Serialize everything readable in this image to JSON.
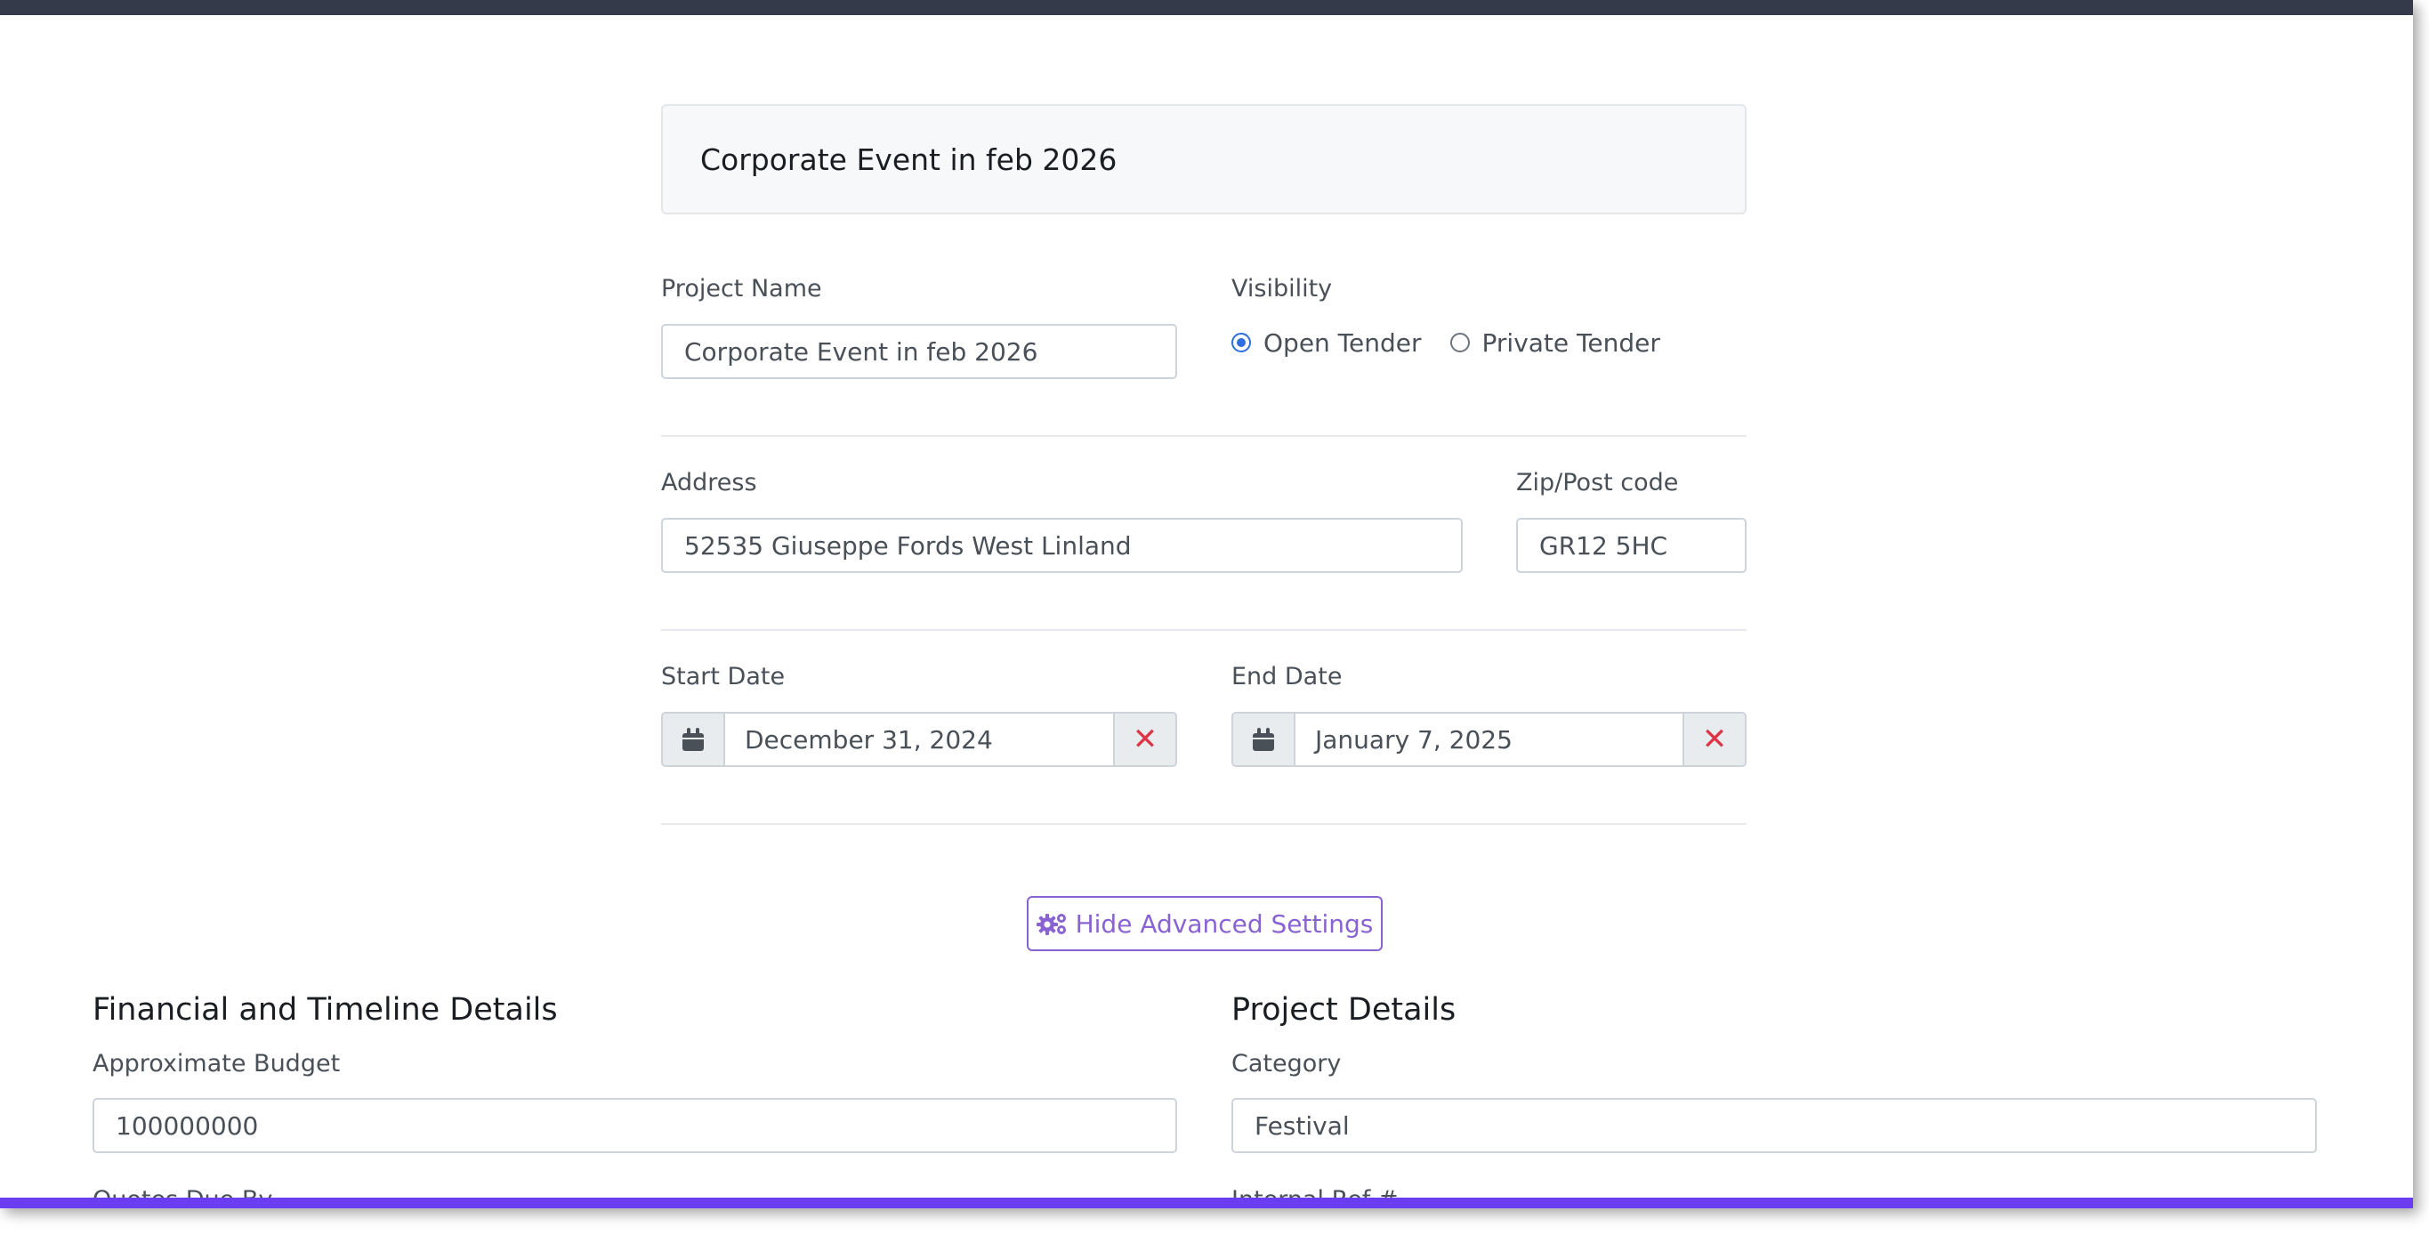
{
  "header": {
    "title": "Corporate Event in feb 2026"
  },
  "project_name": {
    "label": "Project Name",
    "value": "Corporate Event in feb 2026"
  },
  "visibility": {
    "label": "Visibility",
    "options": [
      {
        "label": "Open Tender",
        "checked": true
      },
      {
        "label": "Private Tender",
        "checked": false
      }
    ]
  },
  "address": {
    "label": "Address",
    "value": "52535 Giuseppe Fords West Linland"
  },
  "zip": {
    "label": "Zip/Post code",
    "value": "GR12 5HC"
  },
  "start_date": {
    "label": "Start Date",
    "value": "December 31, 2024"
  },
  "end_date": {
    "label": "End Date",
    "value": "January 7, 2025"
  },
  "advanced": {
    "button_label": "Hide Advanced Settings"
  },
  "financial": {
    "title": "Financial and Timeline Details",
    "budget_label": "Approximate Budget",
    "budget_value": "100000000",
    "quotes_label": "Quotes Due By"
  },
  "project_details": {
    "title": "Project Details",
    "category_label": "Category",
    "category_value": "Festival",
    "internal_ref_label": "Internal Ref #"
  },
  "colors": {
    "topbar": "#343a4a",
    "accent_purple": "#8a63d2",
    "radio_blue": "#2f6fdf",
    "clear_red": "#dc3545",
    "bottom_border": "#6a3df0"
  },
  "icons": [
    "calendar-icon",
    "close-icon",
    "gears-icon"
  ]
}
